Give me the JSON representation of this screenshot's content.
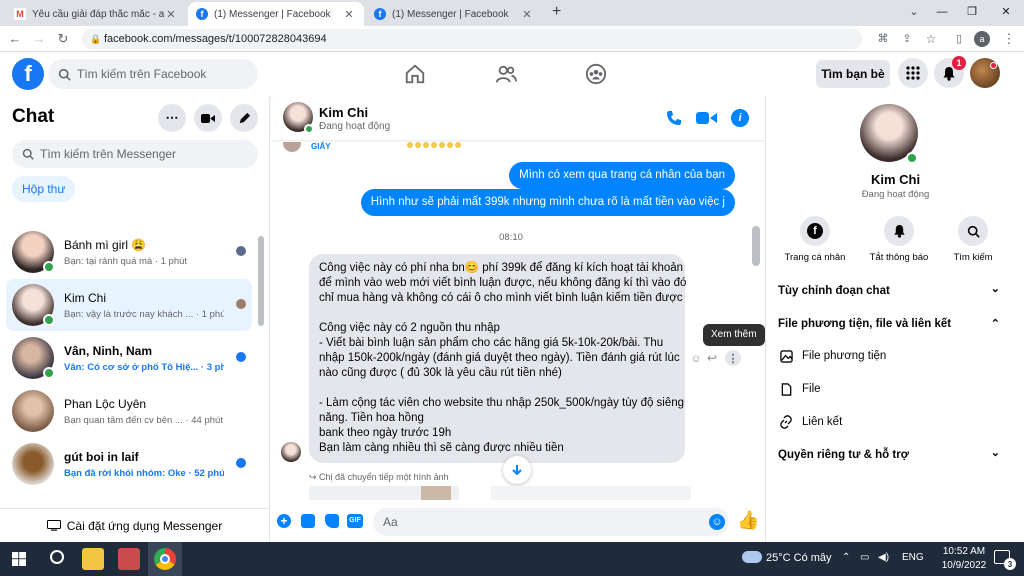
{
  "browser": {
    "tabs": [
      {
        "title": "Yêu cầu giải đáp thắc mắc - anhtr",
        "icon": "gmail-icon",
        "active": false
      },
      {
        "title": "(1) Messenger | Facebook",
        "icon": "facebook-icon",
        "active": true
      },
      {
        "title": "(1) Messenger | Facebook",
        "icon": "facebook-icon",
        "active": false
      }
    ],
    "new_tab": "+",
    "url": "facebook.com/messages/t/100072828043694",
    "profile_initial": "a"
  },
  "header": {
    "search_placeholder": "Tìm kiếm trên Facebook",
    "find_friends": "Tìm bạn bè",
    "notification_count": "1"
  },
  "sidebar": {
    "title": "Chat",
    "search_placeholder": "Tìm kiếm trên Messenger",
    "inbox_label": "Hộp thư",
    "install_label": "Cài đặt ứng dụng Messenger",
    "conversations": [
      {
        "name": "Bánh mì girl 😩",
        "snippet": "Bạn: tại rảnh quá mà · 1 phút",
        "unread": false
      },
      {
        "name": "Kim Chi",
        "snippet": "Bạn: vậy là trước nay khách ... · 1 phút",
        "unread": false
      },
      {
        "name": "Vân, Ninh, Nam",
        "snippet": "Vân: Có cơ sở ở phố Tô Hiệ... · 3 phút",
        "unread": true
      },
      {
        "name": "Phan Lộc Uyên",
        "snippet": "Bạn quan tâm đến cv bên ... · 44 phút",
        "unread": false
      },
      {
        "name": "gút boi in laif",
        "snippet": "Bạn đã rời khỏi nhóm: Oke · 52 phút",
        "unread": true
      }
    ]
  },
  "chat": {
    "name": "Kim Chi",
    "status": "Đang hoạt động",
    "partial_label": "GIẤY",
    "messages_me": [
      "Mình có xem qua trang cá nhân của bạn",
      "Hình như sẽ phải mất 399k nhưng mình chưa rõ là mất tiền vào việc j"
    ],
    "time_divider": "08:10",
    "message_them_lines": [
      "Công việc này có phí nha bn😊 phí 399k để đăng kí kích hoạt tài khoản",
      "để mình vào web mới viết bình luận được, nếu không đăng kí thì vào đó",
      "chỉ mua hàng và không có cái ô cho mình viết bình luận kiếm tiền được",
      "",
      "Công việc này có 2 nguồn thu nhập",
      "- Viết bài bình luận sản phẩm cho các hãng giá 5k-10k-20k/bài. Thu",
      "nhập 150k-200k/ngày (đánh giá duyệt theo ngày). Tiền đánh giá rút lúc",
      "nào cũng được ( đủ 30k là yêu cầu rút tiền nhé)",
      "",
      "- Làm cộng tác viên cho website thu nhập 250k_500k/ngày tùy độ siêng",
      "năng. Tiền hoa hồng",
      "bank theo ngày trước 19h",
      "Bạn làm càng nhiều thì sẽ càng được nhiều tiền"
    ],
    "tooltip": "Xem thêm",
    "forwarded_label": "Chị đã chuyển tiếp một hình ảnh",
    "composer_placeholder": "Aa"
  },
  "profile": {
    "name": "Kim Chi",
    "status": "Đang hoạt động",
    "actions": [
      {
        "label": "Trang cá nhân",
        "icon": "facebook-icon"
      },
      {
        "label": "Tắt thông báo",
        "icon": "bell-icon"
      },
      {
        "label": "Tìm kiếm",
        "icon": "search-icon"
      }
    ],
    "sections": {
      "customize": "Tùy chỉnh đoạn chat",
      "media": "File phương tiện, file và liên kết",
      "media_items": [
        "File phương tiện",
        "File",
        "Liên kết"
      ],
      "privacy": "Quyền riêng tư & hỗ trợ"
    }
  },
  "taskbar": {
    "weather": "25°C  Có mây",
    "lang": "ENG",
    "time": "10:52 AM",
    "date": "10/9/2022",
    "notif_count": "3"
  },
  "colors": {
    "brand": "#1877f2",
    "messenger_blue": "#0084ff",
    "online": "#31a24c",
    "bubble_gray": "#e4e6eb"
  }
}
